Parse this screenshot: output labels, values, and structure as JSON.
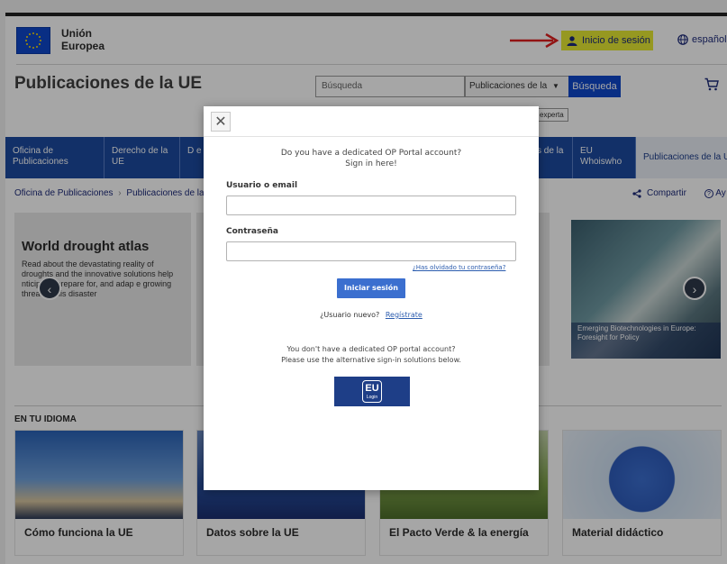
{
  "header": {
    "logo_line1": "Unión",
    "logo_line2": "Europea",
    "login_label": "Inicio de sesión",
    "language": "español",
    "site_title": "Publicaciones de la UE",
    "search_placeholder": "Búsqueda",
    "search_scope": "Publicaciones de la",
    "search_button": "Búsqueda",
    "advanced_search": "experta"
  },
  "nav": {
    "items": [
      {
        "label": "Oficina de Publicaciones"
      },
      {
        "label": "Derecho de la UE"
      },
      {
        "label": "D e"
      },
      {
        "label": "s de la"
      },
      {
        "label": "EU Whoiswho"
      },
      {
        "label": "Publicaciones de la U"
      }
    ]
  },
  "breadcrumb": {
    "item1": "Oficina de Publicaciones",
    "sep": "›",
    "item2": "Publicaciones de la U"
  },
  "actions": {
    "share": "Compartir",
    "help": "Ay"
  },
  "carousel": {
    "title": "World drought atlas",
    "description": "Read about the devastating reality of droughts and the innovative solutions help    nticipate, prepare for, and adap    e growing threat of this disaster",
    "caption": "Emerging Biotechnologies in Europe: Foresight for Policy"
  },
  "section": {
    "title": "EN TU IDIOMA",
    "cards": [
      {
        "label": "Cómo funciona la UE"
      },
      {
        "label": "Datos sobre la UE"
      },
      {
        "label": "El Pacto Verde & la energía"
      },
      {
        "label": "Material didáctico"
      }
    ]
  },
  "modal": {
    "close": "✕",
    "intro_line1": "Do you have a dedicated OP Portal account?",
    "intro_line2": "Sign in here!",
    "username_label": "Usuario o email",
    "password_label": "Contraseña",
    "forgot": "¿Has olvidado tu contraseña?",
    "submit": "Iniciar sesión",
    "new_user": "¿Usuario nuevo?",
    "register": "Regístrate",
    "alt_line1": "You don't have a dedicated OP portal account?",
    "alt_line2": "Please use the alternative sign-in solutions below.",
    "eu_login_top": "EU",
    "eu_login_bottom": "Login"
  },
  "colors": {
    "eu_blue": "#0e47cb",
    "nav_blue": "#1c4ba0",
    "login_highlight": "#e6ea33",
    "arrow_red": "#e02020",
    "submit_blue": "#3b6fcf"
  }
}
